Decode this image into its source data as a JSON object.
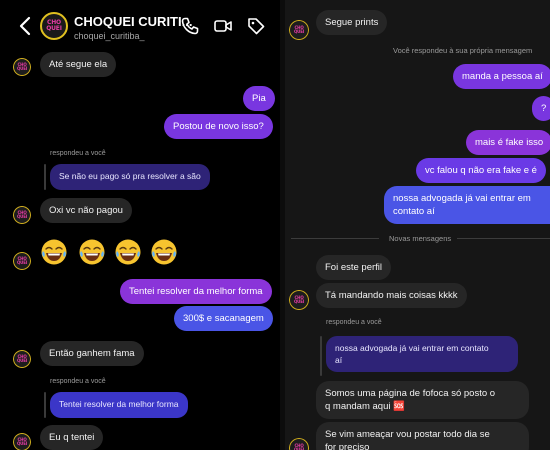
{
  "left_panel": {
    "header": {
      "title": "CHOQUEI CURITI...",
      "subtitle": "choquei_curitiba_",
      "logo_text": [
        "CHO",
        "QUEI"
      ],
      "icons": [
        "back-icon",
        "phone-icon",
        "video-icon",
        "tag-icon"
      ]
    },
    "messages": [
      {
        "side": "in",
        "text": "Até segue ela"
      },
      {
        "side": "out",
        "text": "Pia"
      },
      {
        "side": "out",
        "text": "Postou de novo isso?"
      },
      {
        "side": "in",
        "reply_label": "respondeu a você",
        "quote": "Se não eu pago só pra resolver a são"
      },
      {
        "side": "in",
        "text": "Oxi vc não pagou"
      },
      {
        "side": "in",
        "emoji": "😂😂😂😂"
      },
      {
        "side": "out",
        "text": "Tentei resolver da melhor forma"
      },
      {
        "side": "out",
        "text": "300$ e sacanagem"
      },
      {
        "side": "in",
        "text": "Então ganhem fama"
      },
      {
        "side": "in",
        "reply_label": "respondeu a você",
        "quote": "Tentei resolver da melhor forma"
      },
      {
        "side": "in",
        "text": "Eu q tentei"
      }
    ]
  },
  "right_panel": {
    "messages": [
      {
        "side": "in",
        "text": "Segue prints"
      },
      {
        "type": "system",
        "text": "Você respondeu à sua própria mensagem"
      },
      {
        "side": "out",
        "text": "manda a pessoa aí"
      },
      {
        "side": "out",
        "text": "?"
      },
      {
        "side": "out",
        "text": "mais é fake isso"
      },
      {
        "side": "out",
        "text": "vc falou q não era fake e é"
      },
      {
        "side": "out",
        "text_lines": [
          "nossa advogada já vai entrar em",
          "contato aí"
        ]
      },
      {
        "type": "separator",
        "text": "Novas mensagens"
      },
      {
        "side": "in",
        "text": "Foi este perfil"
      },
      {
        "side": "in",
        "text": "Tá mandando mais coisas kkkk"
      },
      {
        "side": "in",
        "reply_label": "respondeu a você",
        "quote_lines": [
          "nossa advogada já vai entrar em contato",
          "aí"
        ]
      },
      {
        "side": "in",
        "text_lines": [
          "Somos uma página de fofoca só posto o",
          "q mandam aqui 🆘"
        ]
      },
      {
        "side": "in",
        "text_lines": [
          "Se vim ameaçar vou postar todo dia se",
          "for preciso"
        ]
      }
    ]
  }
}
